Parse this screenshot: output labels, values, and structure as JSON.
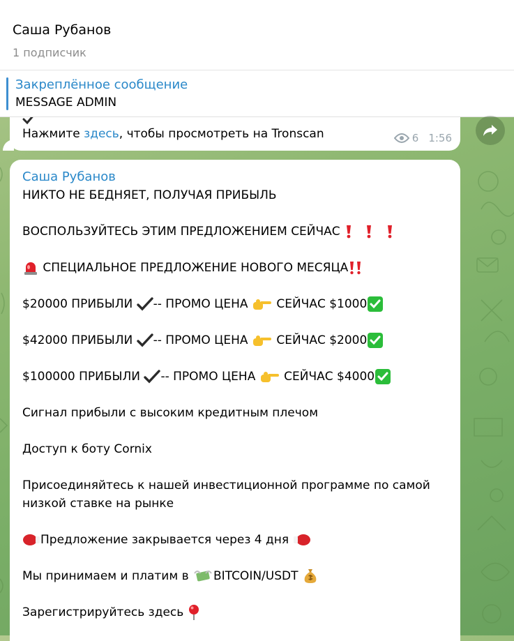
{
  "header": {
    "title": "Саша Рубанов",
    "subtitle": "1 подписчик"
  },
  "pinned": {
    "title": "Закреплённое сообщение",
    "text": "MESSAGE ADMIN"
  },
  "message1": {
    "line_prefix": "Нажмите ",
    "link_text": "здесь",
    "line_suffix": ", чтобы просмотреть на Tronscan",
    "views": "6",
    "time": "1:56"
  },
  "message2": {
    "author": "Саша Рубанов",
    "lines": {
      "l1": "НИКТО НЕ БЕДНЯЕТ, ПОЛУЧАЯ ПРИБЫЛЬ",
      "l2": "ВОСПОЛЬЗУЙТЕСЬ ЭТИМ ПРЕДЛОЖЕНИЕМ СЕЙЧАС",
      "l3": "СПЕЦИАЛЬНОЕ ПРЕДЛОЖЕНИЕ НОВОГО МЕСЯЦА",
      "o1a": "$20000 ПРИБЫЛИ",
      "o1b": "-- ПРОМО ЦЕНА",
      "o1c": "СЕЙЧАС $1000",
      "o2a": "$42000 ПРИБЫЛИ",
      "o2b": "-- ПРОМО ЦЕНА",
      "o2c": "СЕЙЧАС $2000",
      "o3a": "$100000 ПРИБЫЛИ",
      "o3b": "-- ПРОМО ЦЕНА",
      "o3c": "СЕЙЧАС $4000",
      "l7": "Сигнал прибыли с высоким кредитным плечом",
      "l8": "Доступ к боту Cornix",
      "l9": "Присоединяйтесь к нашей инвестиционной программе по самой низкой ставке на рынке",
      "l10": "Предложение закрывается через 4 дня",
      "l11a": "Мы принимаем и платим в",
      "l11b": "BITCOIN/USDT",
      "l12": "Зарегистрируйтесь здесь"
    }
  },
  "icons": {
    "views": "eye-icon",
    "share": "share-arrow-icon",
    "exclamation": "red-exclamation-icon",
    "siren": "siren-icon",
    "double_exclamation": "double-exclamation-icon",
    "check": "check-mark-icon",
    "pointing": "pointing-hand-icon",
    "checkbox": "green-check-box-icon",
    "boxing": "boxing-glove-icon",
    "money_wings": "money-with-wings-icon",
    "money_bag": "money-bag-icon",
    "pin": "round-pushpin-icon"
  },
  "colors": {
    "accent": "#2a88c9",
    "muted": "#8c8c8c",
    "meta": "#9aa6ae",
    "bubble": "#ffffff"
  }
}
